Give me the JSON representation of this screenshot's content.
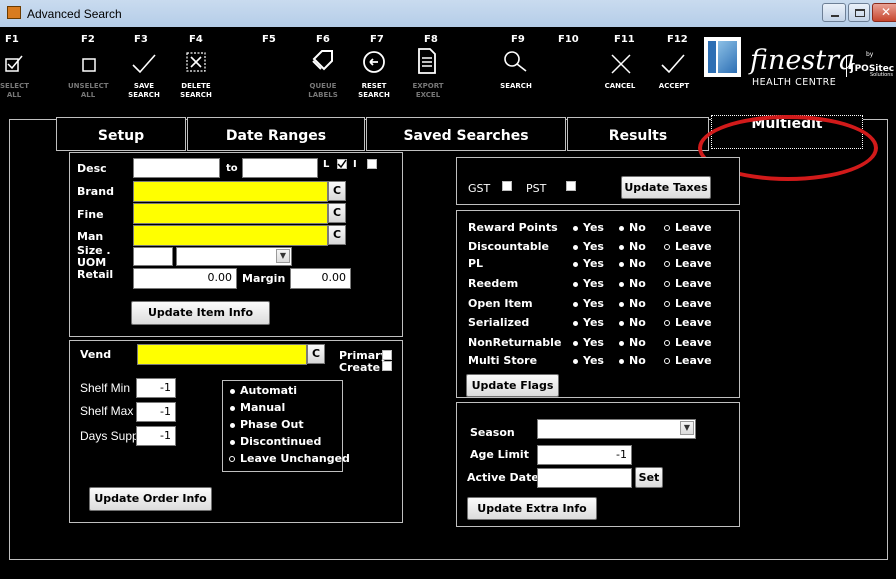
{
  "window": {
    "title": "Advanced Search"
  },
  "toolbar": {
    "items": [
      {
        "key": "F1",
        "label1": "SELECT",
        "label2": "ALL",
        "icon": "checkbox-checked-icon"
      },
      {
        "key": "F2",
        "label1": "UNSELECT",
        "label2": "ALL",
        "icon": "checkbox-empty-icon"
      },
      {
        "key": "F3",
        "label1": "SAVE",
        "label2": "SEARCH",
        "icon": "checkmark-icon"
      },
      {
        "key": "F4",
        "label1": "DELETE",
        "label2": "SEARCH",
        "icon": "delete-box-icon"
      },
      {
        "key": "F5",
        "label1": "",
        "label2": ""
      },
      {
        "key": "F6",
        "label1": "QUEUE",
        "label2": "LABELS",
        "icon": "label-tag-icon"
      },
      {
        "key": "F7",
        "label1": "RESET",
        "label2": "SEARCH",
        "icon": "reset-icon"
      },
      {
        "key": "F8",
        "label1": "EXPORT",
        "label2": "EXCEL",
        "icon": "document-icon"
      },
      {
        "key": "F9",
        "label1": "SEARCH",
        "label2": "",
        "icon": "search-icon"
      },
      {
        "key": "F10",
        "label1": "",
        "label2": ""
      },
      {
        "key": "F11",
        "label1": "CANCEL",
        "label2": "",
        "icon": "close-icon"
      },
      {
        "key": "F12",
        "label1": "ACCEPT",
        "label2": "",
        "icon": "checkmark-icon"
      }
    ]
  },
  "logo": {
    "name": "finestra",
    "sub": "HEALTH CENTRE",
    "by": "by",
    "partner": "POSitec",
    "partner_sub": "Solutions"
  },
  "tabs": [
    "Setup",
    "Date Ranges",
    "Saved Searches",
    "Results",
    "Multiedit"
  ],
  "item_info": {
    "desc_label": "Desc",
    "to_label": "to",
    "l_label": "L",
    "i_label": "I",
    "brand_label": "Brand",
    "fine_label": "Fine",
    "man_label": "Man",
    "size_label": "Size .",
    "uom_label": "UOM",
    "retail_label": "Retail",
    "retail_value": "0.00",
    "margin_label": "Margin",
    "margin_value": "0.00",
    "c_label": "C",
    "update_button": "Update Item Info"
  },
  "order_info": {
    "vend_label": "Vend",
    "c_label": "C",
    "primary_label": "Primary",
    "create_label": "Create",
    "shelf_min_label": "Shelf Min",
    "shelf_min_value": "-1",
    "shelf_max_label": "Shelf Max",
    "shelf_max_value": "-1",
    "days_supp_label": "Days Supp",
    "days_supp_value": "-1",
    "options": [
      "Automati",
      "Manual",
      "Phase Out",
      "Discontinued",
      "Leave Unchanged"
    ],
    "selected_option": "Leave Unchanged",
    "update_button": "Update Order Info"
  },
  "taxes": {
    "gst_label": "GST",
    "pst_label": "PST",
    "update_button": "Update Taxes"
  },
  "flags": {
    "rows": [
      "Reward Points",
      "Discountable",
      "PL",
      "Reedem",
      "Open Item",
      "Serialized",
      "NonReturnable",
      "Multi Store"
    ],
    "yes_label": "Yes",
    "no_label": "No",
    "leave_label": "Leave",
    "selected": "Leave",
    "update_button": "Update Flags"
  },
  "extra_info": {
    "season_label": "Season",
    "age_limit_label": "Age Limit",
    "age_limit_value": "-1",
    "active_date_label": "Active Date",
    "set_button": "Set",
    "update_button": "Update Extra Info"
  },
  "colors": {
    "highlight_yellow": "#ffff00",
    "annotation_red": "#d11a1a",
    "background": "#000000"
  }
}
